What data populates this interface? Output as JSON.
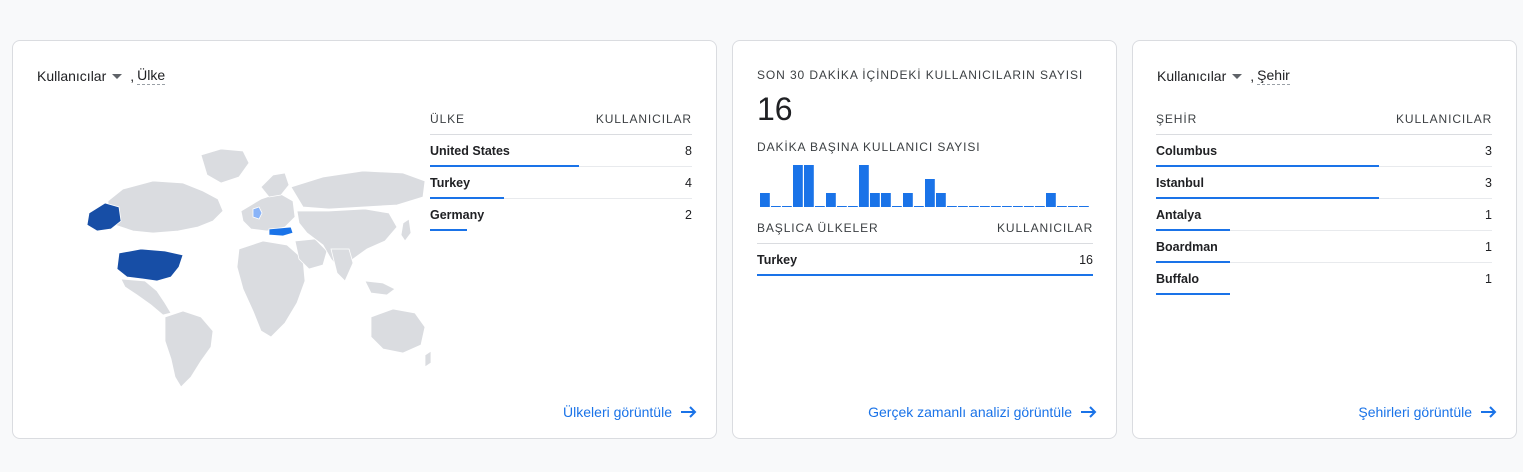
{
  "country_card": {
    "dimension_label": "Kullanıcılar",
    "separator": ",",
    "secondary_dimension": "Ülke",
    "table": {
      "col_label": "ÜLKE",
      "col_value": "KULLANICILAR",
      "rows": [
        {
          "name": "United States",
          "value": "8",
          "share": 1.0
        },
        {
          "name": "Turkey",
          "value": "4",
          "share": 0.5
        },
        {
          "name": "Germany",
          "value": "2",
          "share": 0.25
        }
      ]
    },
    "map": {
      "base_color": "#dadce0",
      "highlight": [
        {
          "country": "United States",
          "color": "#174ea6"
        },
        {
          "country": "Turkey",
          "color": "#1a73e8"
        },
        {
          "country": "Germany",
          "color": "#8ab4f8"
        }
      ]
    },
    "link_label": "Ülkeleri görüntüle"
  },
  "realtime_card": {
    "title": "SON 30 DAKİKA İÇİNDEKİ KULLANICILARIN SAYISI",
    "count": "16",
    "per_minute_label": "DAKİKA BAŞINA KULLANICI SAYISI",
    "per_minute": [
      1,
      0,
      0,
      3,
      3,
      0,
      1,
      0,
      0,
      3,
      1,
      1,
      0,
      1,
      0,
      2,
      1,
      0,
      0,
      0,
      0,
      0,
      0,
      0,
      0,
      0,
      1,
      0,
      0,
      0
    ],
    "table": {
      "col_label": "BAŞLICA ÜLKELER",
      "col_value": "KULLANICILAR",
      "rows": [
        {
          "name": "Turkey",
          "value": "16",
          "share": 1.0
        }
      ]
    },
    "link_label": "Gerçek zamanlı analizi görüntüle"
  },
  "city_card": {
    "dimension_label": "Kullanıcılar",
    "separator": ",",
    "secondary_dimension": "Şehir",
    "table": {
      "col_label": "ŞEHİR",
      "col_value": "KULLANICILAR",
      "rows": [
        {
          "name": "Columbus",
          "value": "3",
          "share": 1.0
        },
        {
          "name": "Istanbul",
          "value": "3",
          "share": 1.0
        },
        {
          "name": "Antalya",
          "value": "1",
          "share": 0.333
        },
        {
          "name": "Boardman",
          "value": "1",
          "share": 0.333
        },
        {
          "name": "Buffalo",
          "value": "1",
          "share": 0.333
        }
      ]
    },
    "link_label": "Şehirleri görüntüle"
  },
  "colors": {
    "accent": "#1a73e8",
    "bar": "#1a73e8",
    "border": "#dadce0"
  },
  "icons": {
    "dropdown": "caret-down-icon",
    "link_arrow": "arrow-right-icon"
  }
}
